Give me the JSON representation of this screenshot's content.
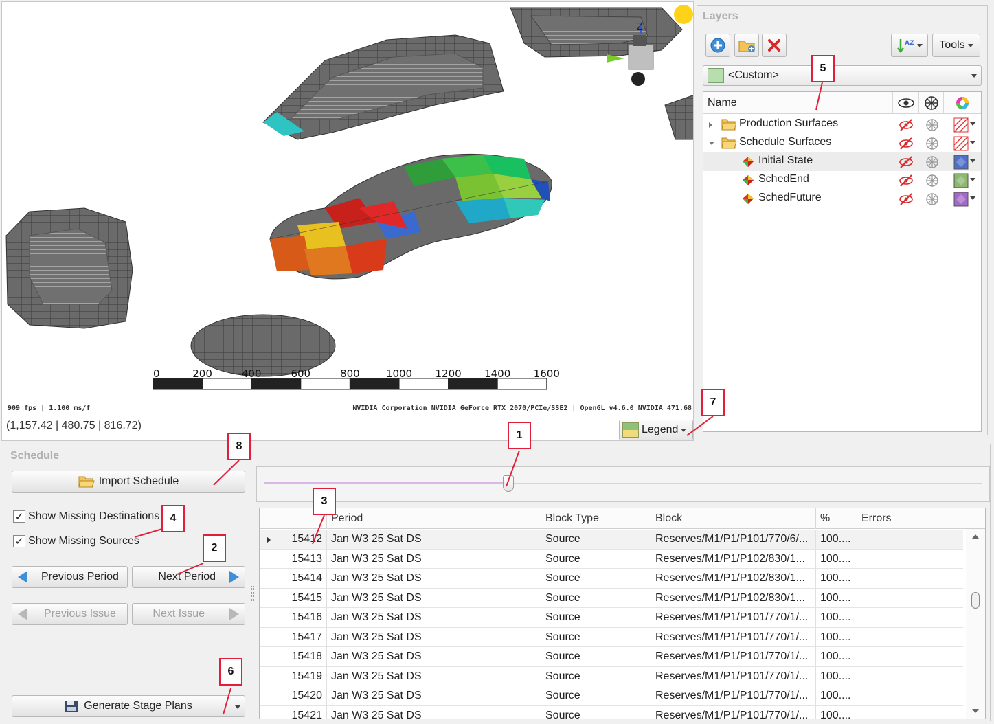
{
  "viewport": {
    "fps_text": "909 fps | 1.100 ms/f",
    "gpu_text": "NVIDIA Corporation NVIDIA GeForce RTX 2070/PCIe/SSE2 | OpenGL v4.6.0 NVIDIA 471.68",
    "coords": "(1,157.42 | 480.75 | 816.72)",
    "scale_labels": [
      "0",
      "200",
      "400",
      "600",
      "800",
      "1000",
      "1200",
      "1400",
      "1600"
    ],
    "axis_label": "Z",
    "legend_label": "Legend"
  },
  "layers": {
    "title": "Layers",
    "tools_label": "Tools",
    "sort_icon_text": "AZ",
    "selector_value": "<Custom>",
    "columns": {
      "name": "Name"
    },
    "items": [
      {
        "label": "Production Surfaces",
        "kind": "folder",
        "state": "collapsed",
        "level": 0,
        "swatch": "hatch"
      },
      {
        "label": "Schedule Surfaces",
        "kind": "folder",
        "state": "expanded",
        "level": 0,
        "swatch": "hatch"
      },
      {
        "label": "Initial State",
        "kind": "surface",
        "level": 1,
        "selected": true,
        "swatch": "#4f6fc8"
      },
      {
        "label": "SchedEnd",
        "kind": "surface",
        "level": 1,
        "swatch": "#8cb870"
      },
      {
        "label": "SchedFuture",
        "kind": "surface",
        "level": 1,
        "swatch": "#a468c8"
      }
    ]
  },
  "schedule": {
    "title": "Schedule",
    "import_label": "Import Schedule",
    "show_missing_destinations": "Show Missing Destinations",
    "show_missing_sources": "Show Missing Sources",
    "prev_period": "Previous Period",
    "next_period": "Next Period",
    "prev_issue": "Previous Issue",
    "next_issue": "Next Issue",
    "generate_label": "Generate Stage Plans",
    "slider_position": 0.34,
    "columns": [
      "Period",
      "Block Type",
      "Block",
      "%",
      "Errors"
    ],
    "rows": [
      {
        "id": "15412",
        "period": "Jan W3 25 Sat DS",
        "type": "Source",
        "block": "Reserves/M1/P1/P101/770/6/...",
        "pct": "100....",
        "errors": ""
      },
      {
        "id": "15413",
        "period": "Jan W3 25 Sat DS",
        "type": "Source",
        "block": "Reserves/M1/P1/P102/830/1...",
        "pct": "100....",
        "errors": ""
      },
      {
        "id": "15414",
        "period": "Jan W3 25 Sat DS",
        "type": "Source",
        "block": "Reserves/M1/P1/P102/830/1...",
        "pct": "100....",
        "errors": ""
      },
      {
        "id": "15415",
        "period": "Jan W3 25 Sat DS",
        "type": "Source",
        "block": "Reserves/M1/P1/P102/830/1...",
        "pct": "100....",
        "errors": ""
      },
      {
        "id": "15416",
        "period": "Jan W3 25 Sat DS",
        "type": "Source",
        "block": "Reserves/M1/P1/P101/770/1/...",
        "pct": "100....",
        "errors": ""
      },
      {
        "id": "15417",
        "period": "Jan W3 25 Sat DS",
        "type": "Source",
        "block": "Reserves/M1/P1/P101/770/1/...",
        "pct": "100....",
        "errors": ""
      },
      {
        "id": "15418",
        "period": "Jan W3 25 Sat DS",
        "type": "Source",
        "block": "Reserves/M1/P1/P101/770/1/...",
        "pct": "100....",
        "errors": ""
      },
      {
        "id": "15419",
        "period": "Jan W3 25 Sat DS",
        "type": "Source",
        "block": "Reserves/M1/P1/P101/770/1/...",
        "pct": "100....",
        "errors": ""
      },
      {
        "id": "15420",
        "period": "Jan W3 25 Sat DS",
        "type": "Source",
        "block": "Reserves/M1/P1/P101/770/1/...",
        "pct": "100....",
        "errors": ""
      },
      {
        "id": "15421",
        "period": "Jan W3 25 Sat DS",
        "type": "Source",
        "block": "Reserves/M1/P1/P101/770/1/...",
        "pct": "100....",
        "errors": ""
      }
    ]
  },
  "callouts": [
    "1",
    "2",
    "3",
    "4",
    "5",
    "6",
    "7",
    "8"
  ],
  "colors": {
    "callout_border": "#e0203a",
    "accent_blue": "#3d8fd8",
    "hatch_red": "#e03030"
  }
}
